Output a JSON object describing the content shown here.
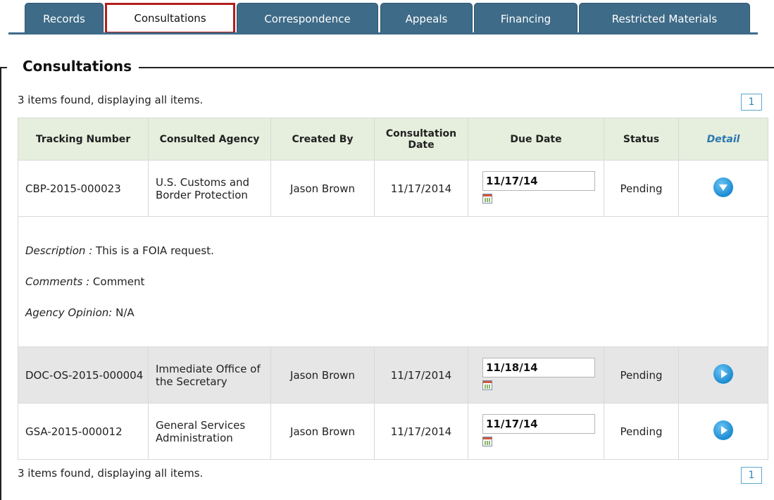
{
  "tabs": [
    {
      "label": "Records"
    },
    {
      "label": "Consultations"
    },
    {
      "label": "Correspondence"
    },
    {
      "label": "Appeals"
    },
    {
      "label": "Financing"
    },
    {
      "label": "Restricted Materials"
    }
  ],
  "section": {
    "title": "Consultations",
    "summary_top": "3 items found, displaying all items.",
    "summary_bottom": "3 items found, displaying all items.",
    "page": "1"
  },
  "table": {
    "headers": [
      "Tracking Number",
      "Consulted Agency",
      "Created By",
      "Consultation Date",
      "Due Date",
      "Status",
      "Detail"
    ],
    "rows": [
      {
        "tracking": "CBP-2015-000023",
        "agency": "U.S. Customs and Border Protection",
        "created_by": "Jason Brown",
        "consult_date": "11/17/2014",
        "due": "11/17/14",
        "status": "Pending"
      },
      {
        "tracking": "DOC-OS-2015-000004",
        "agency": "Immediate Office of the Secretary",
        "created_by": "Jason Brown",
        "consult_date": "11/17/2014",
        "due": "11/18/14",
        "status": "Pending"
      },
      {
        "tracking": "GSA-2015-000012",
        "agency": "General Services Administration",
        "created_by": "Jason Brown",
        "consult_date": "11/17/2014",
        "due": "11/17/14",
        "status": "Pending"
      }
    ],
    "expanded": {
      "description_label": "Description :",
      "description": "This is a FOIA request.",
      "comments_label": "Comments :",
      "comments": "Comment",
      "opinion_label": "Agency Opinion:",
      "opinion": "N/A"
    }
  },
  "icons": {
    "collapse": "chevron-down-icon",
    "expand": "chevron-right-icon",
    "calendar": "calendar-icon"
  }
}
